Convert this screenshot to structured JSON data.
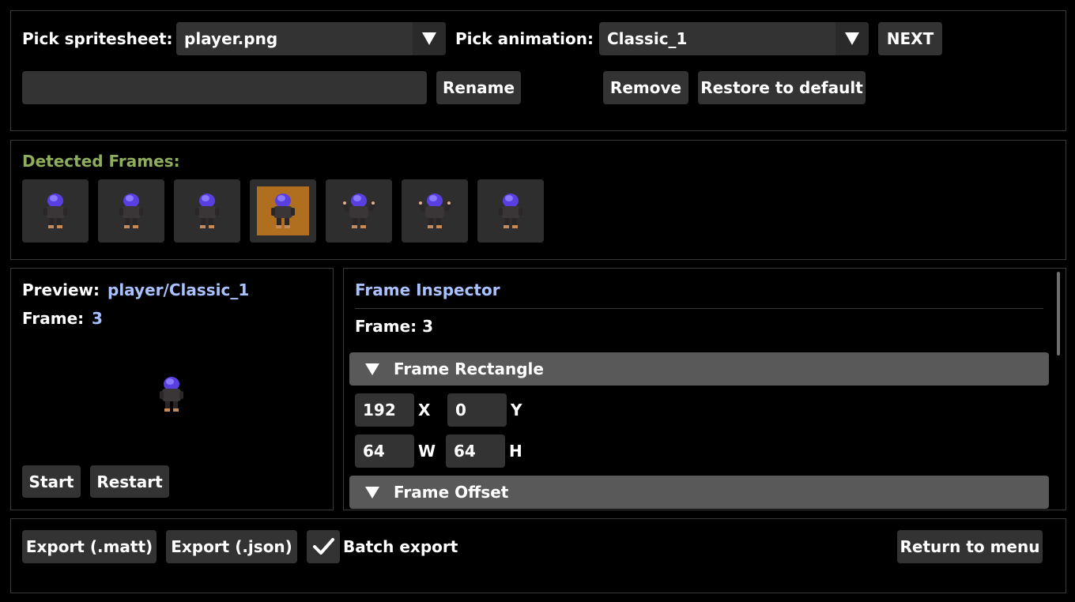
{
  "top": {
    "spritesheet_label": "Pick spritesheet:",
    "spritesheet_value": "player.png",
    "animation_label": "Pick animation:",
    "animation_value": "Classic_1",
    "next_label": "NEXT",
    "rename_value": "",
    "rename_label": "Rename",
    "remove_label": "Remove",
    "restore_label": "Restore to default"
  },
  "frames": {
    "title": "Detected Frames:",
    "count": 7,
    "selected_index": 3,
    "title_color": "#8fae5c",
    "selected_color": "#b06f1f"
  },
  "preview": {
    "label": "Preview:",
    "name": "player/Classic_1",
    "frame_label": "Frame:",
    "frame_value": "3",
    "start_label": "Start",
    "restart_label": "Restart"
  },
  "inspector": {
    "title": "Frame Inspector",
    "frame_text": "Frame: 3",
    "rect_header": "Frame Rectangle",
    "x_value": "192",
    "x_label": "X",
    "y_value": "0",
    "y_label": "Y",
    "w_value": "64",
    "w_label": "W",
    "h_value": "64",
    "h_label": "H",
    "offset_header": "Frame Offset",
    "accent_color": "#a9c1ff"
  },
  "bottom": {
    "export_matt_label": "Export (.matt)",
    "export_json_label": "Export (.json)",
    "batch_label": "Batch export",
    "batch_checked": true,
    "return_label": "Return to menu"
  }
}
